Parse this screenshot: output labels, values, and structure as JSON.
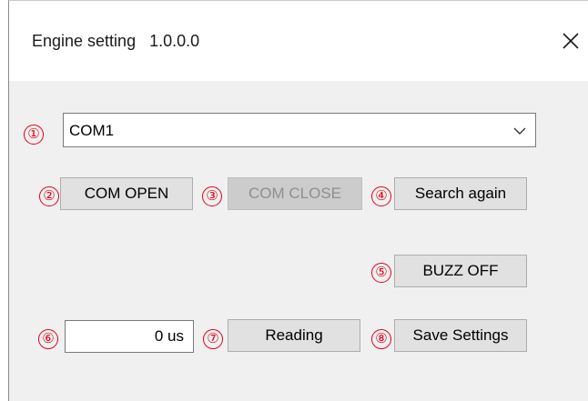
{
  "window": {
    "title": "Engine setting",
    "version": "1.0.0.0"
  },
  "markers": [
    "①",
    "②",
    "③",
    "④",
    "⑤",
    "⑥",
    "⑦",
    "⑧"
  ],
  "port_select": {
    "selected": "COM1"
  },
  "buttons": {
    "com_open": "COM OPEN",
    "com_close": "COM CLOSE",
    "search_again": "Search again",
    "buzz_off": "BUZZ OFF",
    "reading": "Reading",
    "save_settings": "Save Settings"
  },
  "time_field": {
    "value": "0 us"
  },
  "icons": {
    "close": "close-icon",
    "dropdown": "chevron-down-icon"
  },
  "colors": {
    "marker": "#e0001b",
    "button_bg": "#e1e1e1",
    "button_disabled_bg": "#cccccc",
    "window_bg": "#f0f0f0"
  }
}
